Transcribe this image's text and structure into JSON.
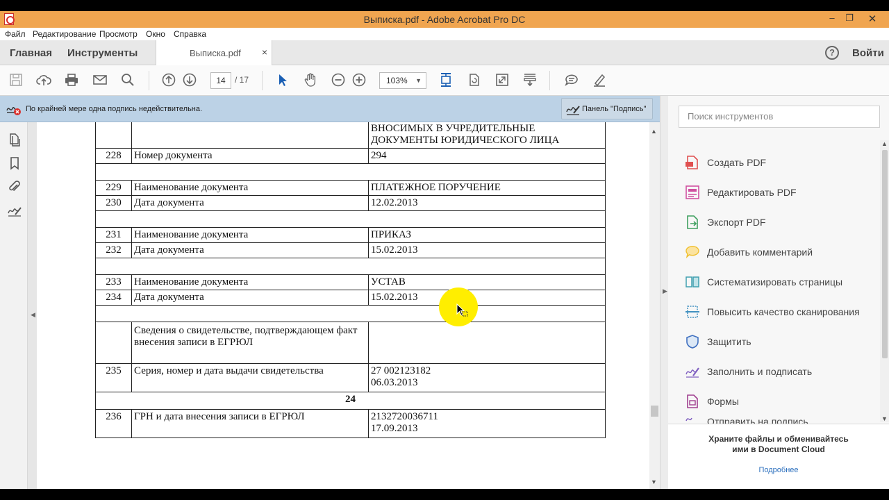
{
  "window": {
    "title": "Выписка.pdf - Adobe Acrobat Pro DC"
  },
  "menu": [
    "Файл",
    "Редактирование",
    "Просмотр",
    "Окно",
    "Справка"
  ],
  "tabs": {
    "home": "Главная",
    "tools": "Инструменты",
    "document": "Выписка.pdf",
    "close": "×",
    "help": "?",
    "login": "Войти"
  },
  "toolbar": {
    "page_current": "14",
    "page_total": "/  17",
    "zoom": "103%"
  },
  "notice": {
    "text": "По крайней мере одна подпись недействительна.",
    "sign_panel": "Панель \"Подпись\""
  },
  "document_table": {
    "rows": [
      {
        "num": "",
        "name": "",
        "value": "ВНОСИМЫХ В УЧРЕДИТЕЛЬНЫЕ ДОКУМЕНТЫ  ЮРИДИЧЕСКОГО ЛИЦА"
      },
      {
        "num": "228",
        "name": "Номер документа",
        "value": "294"
      },
      {
        "num": "229",
        "name": "Наименование документа",
        "value": "ПЛАТЕЖНОЕ ПОРУЧЕНИЕ"
      },
      {
        "num": "230",
        "name": "Дата документа",
        "value": "12.02.2013"
      },
      {
        "num": "231",
        "name": "Наименование документа",
        "value": "ПРИКАЗ"
      },
      {
        "num": "232",
        "name": "Дата документа",
        "value": "15.02.2013"
      },
      {
        "num": "233",
        "name": "Наименование документа",
        "value": "УСТАВ"
      },
      {
        "num": "234",
        "name": "Дата документа",
        "value": "15.02.2013"
      },
      {
        "num": "",
        "name": "Сведения о свидетельстве, подтверждающем факт внесения записи в ЕГРЮЛ",
        "value": ""
      },
      {
        "num": "235",
        "name": "Серия, номер и дата выдачи свидетельства",
        "value": "27 002123182",
        "value2": "06.03.2013"
      },
      {
        "num": "236",
        "name": "ГРН и дата внесения записи в ЕГРЮЛ",
        "value": "2132720036711",
        "value2": "17.09.2013"
      }
    ],
    "page_marker": "24"
  },
  "right_panel": {
    "search_placeholder": "Поиск инструментов",
    "tools": [
      {
        "label": "Создать PDF",
        "icon": "create-pdf-icon",
        "color": "#e05050"
      },
      {
        "label": "Редактировать PDF",
        "icon": "edit-pdf-icon",
        "color": "#d050a0"
      },
      {
        "label": "Экспорт PDF",
        "icon": "export-pdf-icon",
        "color": "#40a060"
      },
      {
        "label": "Добавить комментарий",
        "icon": "comment-icon",
        "color": "#f0c030"
      },
      {
        "label": "Систематизировать страницы",
        "icon": "organize-pages-icon",
        "color": "#40a0b0"
      },
      {
        "label": "Повысить качество сканирования",
        "icon": "enhance-scan-icon",
        "color": "#4090c0"
      },
      {
        "label": "Защитить",
        "icon": "shield-icon",
        "color": "#4070c0"
      },
      {
        "label": "Заполнить и подписать",
        "icon": "fill-sign-icon",
        "color": "#8060c0"
      },
      {
        "label": "Формы",
        "icon": "forms-icon",
        "color": "#a04090"
      },
      {
        "label": "Отправить на подпись",
        "icon": "send-signature-icon",
        "color": "#8060c0"
      }
    ],
    "cloud_text": "Храните файлы и обменивайтесь ими в Document Cloud",
    "cloud_link": "Подробнее"
  }
}
